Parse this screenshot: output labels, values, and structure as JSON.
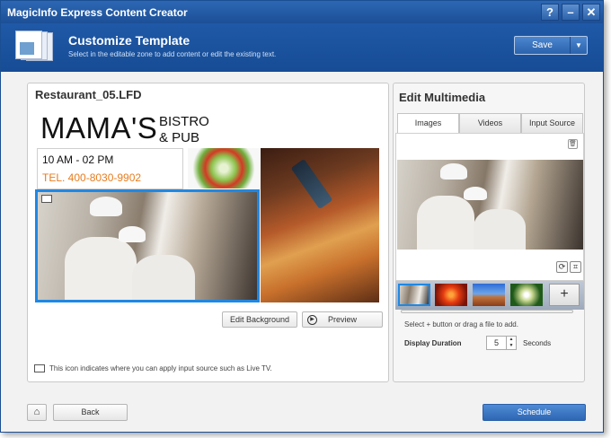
{
  "app": {
    "title": "MagicInfo Express Content Creator"
  },
  "titlebar": {
    "help": "?",
    "minimize": "–",
    "close": "✕"
  },
  "header": {
    "title": "Customize Template",
    "subtitle": "Select in the editable zone to add content or edit the existing text.",
    "save_label": "Save",
    "save_arrow": "▼"
  },
  "left": {
    "filename": "Restaurant_05.LFD",
    "template": {
      "name": "MAMA'S",
      "bistro_line1": "BISTRO",
      "bistro_line2": "& PUB",
      "hours": "10 AM - 02 PM",
      "tel": "TEL. 400-8030-9902"
    },
    "edit_background": "Edit Background",
    "preview": "Preview",
    "note": "This icon indicates where you can apply input source such as Live TV."
  },
  "right": {
    "title": "Edit Multimedia",
    "tabs": [
      "Images",
      "Videos",
      "Input Source"
    ],
    "hint": "Select + button or drag a file to add.",
    "duration_label": "Display Duration",
    "duration_value": "5",
    "duration_unit": "Seconds",
    "add": "+"
  },
  "footer": {
    "back": "Back",
    "schedule": "Schedule"
  },
  "colors": {
    "accent": "#1e88e5",
    "tel": "#e87d1e",
    "header": "#1f59a7"
  }
}
